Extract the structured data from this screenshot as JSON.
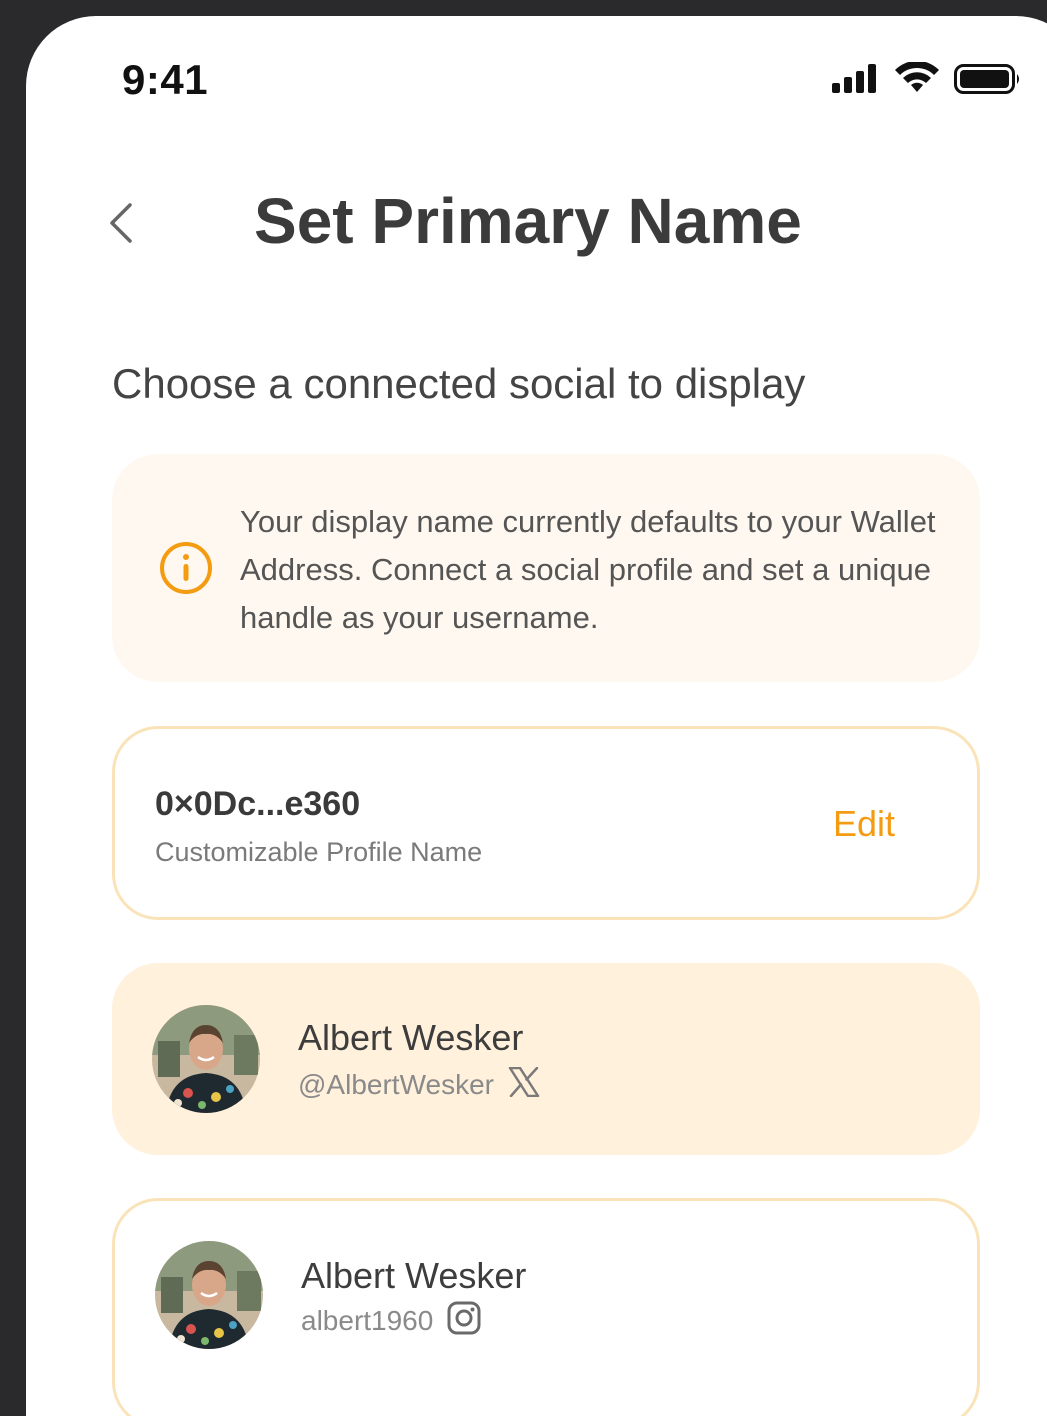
{
  "status_bar": {
    "time": "9:41",
    "icons": [
      "cellular-signal-icon",
      "wifi-icon",
      "battery-icon"
    ]
  },
  "header": {
    "back_icon": "chevron-left-icon",
    "title": "Set Primary Name"
  },
  "section_heading": "Choose a connected social to display",
  "info_banner": {
    "icon": "info-circle-icon",
    "text": "Your display name currently defaults to your Wallet Address. Connect a social profile and set a unique handle as your username."
  },
  "wallet_card": {
    "address": "0×0Dc...e360",
    "subtitle": "Customizable Profile Name",
    "edit_label": "Edit"
  },
  "social_profiles": [
    {
      "name": "Albert Wesker",
      "handle": "@AlbertWesker",
      "platform_icon": "x-logo-icon",
      "selected": true
    },
    {
      "name": "Albert Wesker",
      "handle": "albert1960",
      "platform_icon": "instagram-icon",
      "selected": false
    }
  ],
  "colors": {
    "accent": "#f39c12",
    "banner_bg": "#fff8f0",
    "selected_bg": "#fff1dc",
    "card_border": "#fae3b8",
    "frame": "#2a2a2c"
  }
}
